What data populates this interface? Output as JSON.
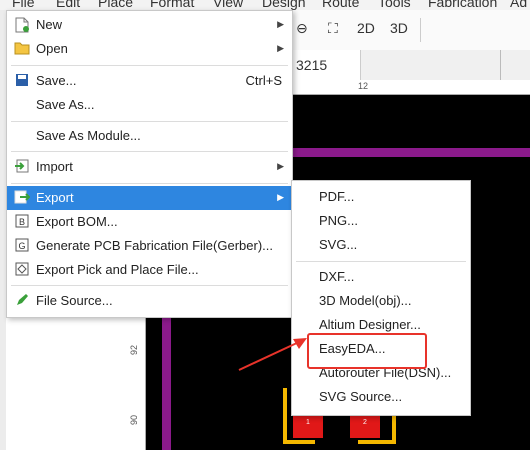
{
  "menubar": {
    "items": [
      "File",
      "Edit",
      "Place",
      "Format",
      "View",
      "Design",
      "Route",
      "Tools",
      "Fabrication",
      "Ad"
    ]
  },
  "toolbar": {
    "zoom_out": "⊖",
    "fit": "⛶",
    "view_2d": "2D",
    "view_3d": "3D"
  },
  "tab": {
    "label": "3215"
  },
  "ruler": {
    "top_mark": "12",
    "left_marks": [
      "92",
      "90"
    ]
  },
  "file_menu": {
    "items": [
      {
        "label": "New",
        "icon": "new-file-icon",
        "submenu": true
      },
      {
        "label": "Open",
        "icon": "open-folder-icon",
        "submenu": true
      },
      {
        "label": "Save...",
        "icon": "save-icon",
        "shortcut": "Ctrl+S"
      },
      {
        "label": "Save As..."
      },
      {
        "label": "Save As Module..."
      },
      {
        "label": "Import",
        "icon": "import-icon",
        "submenu": true
      },
      {
        "label": "Export",
        "icon": "export-icon",
        "submenu": true,
        "active": true
      },
      {
        "label": "Export BOM...",
        "icon": "bom-icon"
      },
      {
        "label": "Generate PCB Fabrication File(Gerber)...",
        "icon": "gerber-icon"
      },
      {
        "label": "Export Pick and Place File...",
        "icon": "pick-place-icon"
      },
      {
        "label": "File Source...",
        "icon": "pencil-icon"
      }
    ]
  },
  "export_menu": {
    "items": [
      "PDF...",
      "PNG...",
      "SVG...",
      "DXF...",
      "3D Model(obj)...",
      "Altium Designer...",
      "EasyEDA...",
      "Autorouter File(DSN)...",
      "SVG Source..."
    ]
  },
  "pads": [
    "1",
    "2"
  ],
  "colors": {
    "accent": "#2e86e0",
    "annotation": "#e8332a",
    "trace": "#8b1a8b",
    "outline": "#f5b800",
    "pad": "#e01818"
  }
}
